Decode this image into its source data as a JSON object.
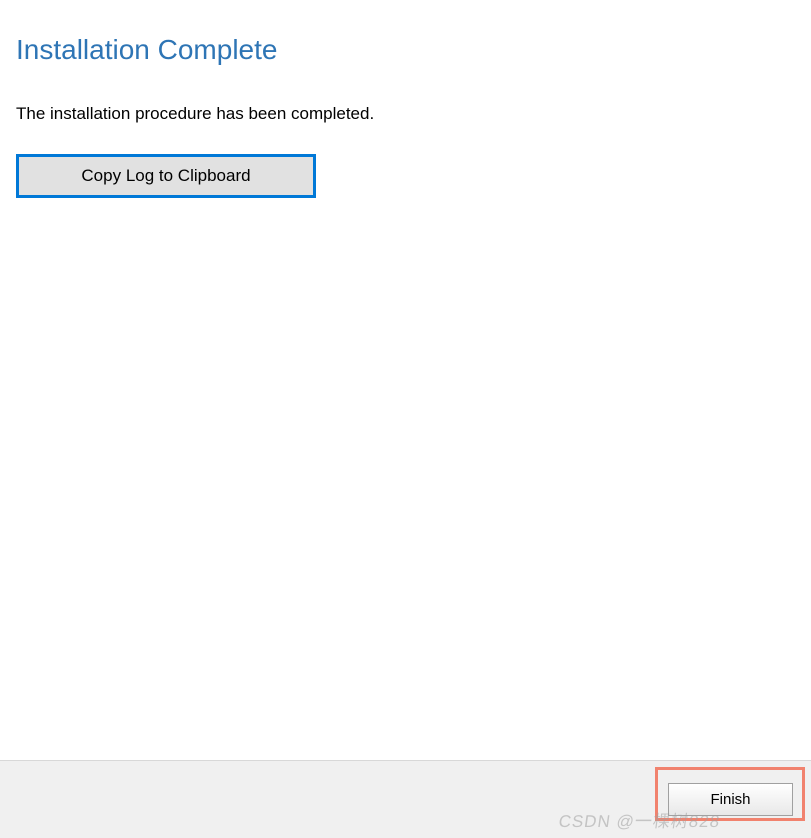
{
  "main": {
    "title": "Installation Complete",
    "description": "The installation procedure has been completed.",
    "copy_log_label": "Copy Log to Clipboard"
  },
  "footer": {
    "finish_label": "Finish"
  },
  "watermark": {
    "text": "CSDN @一棵树828"
  }
}
